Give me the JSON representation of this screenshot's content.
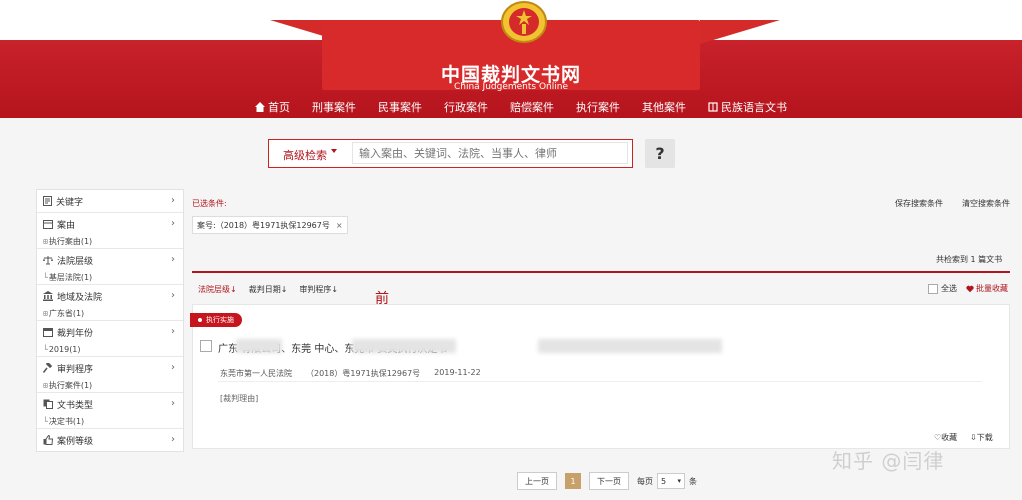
{
  "header": {
    "site_title": "中国裁判文书网",
    "site_subtitle": "China Judgements Online",
    "nav": [
      "首页",
      "刑事案件",
      "民事案件",
      "行政案件",
      "赔偿案件",
      "执行案件",
      "其他案件",
      "民族语言文书"
    ]
  },
  "search": {
    "advanced_label": "高级检索",
    "placeholder": "输入案由、关键词、法院、当事人、律师",
    "help": "?"
  },
  "sidebar": [
    {
      "label": "关键字",
      "icon": "document-icon",
      "sub": ""
    },
    {
      "label": "案由",
      "icon": "list-icon",
      "sub": "执行案由(1)"
    },
    {
      "label": "法院层级",
      "icon": "scales-icon",
      "sub": "基层法院(1)"
    },
    {
      "label": "地域及法院",
      "icon": "courthouse-icon",
      "sub": "广东省(1)"
    },
    {
      "label": "裁判年份",
      "icon": "calendar-icon",
      "sub": "2019(1)"
    },
    {
      "label": "审判程序",
      "icon": "gavel-icon",
      "sub": "执行案件(1)"
    },
    {
      "label": "文书类型",
      "icon": "documents-icon",
      "sub": "决定书(1)"
    },
    {
      "label": "案例等级",
      "icon": "thumbs-up-icon",
      "sub": ""
    }
  ],
  "filters": {
    "selected_label": "已选条件:",
    "save_search": "保存搜索条件",
    "clear_search": "清空搜索条件",
    "tag": "案号:（2018）粤1971执保12967号",
    "tag_close": "×"
  },
  "results": {
    "count_text": "共检索到 1 篇文书",
    "sort": [
      "法院层级",
      "裁判日期",
      "审判程序"
    ],
    "sort_arrow": "↓",
    "select_all": "全选",
    "batch_save": "批量收藏",
    "annotation": "前"
  },
  "card": {
    "badge": "执行实施",
    "title": "广东                有限公司、东莞                                  中心、东莞市                                          资类执行决定书",
    "court": "东莞市第一人民法院",
    "case_no": "（2018）粤1971执保12967号",
    "date": "2019-11-22",
    "reason": "[裁判理由]",
    "collect": "收藏",
    "download": "下载"
  },
  "pagination": {
    "prev": "上一页",
    "page": "1",
    "next": "下一页",
    "per_page_label": "每页",
    "per_page": "5",
    "unit": "条"
  },
  "watermark": "知乎 @闫律",
  "colors": {
    "brand_red": "#b5141d",
    "gold": "#c8a06a"
  }
}
